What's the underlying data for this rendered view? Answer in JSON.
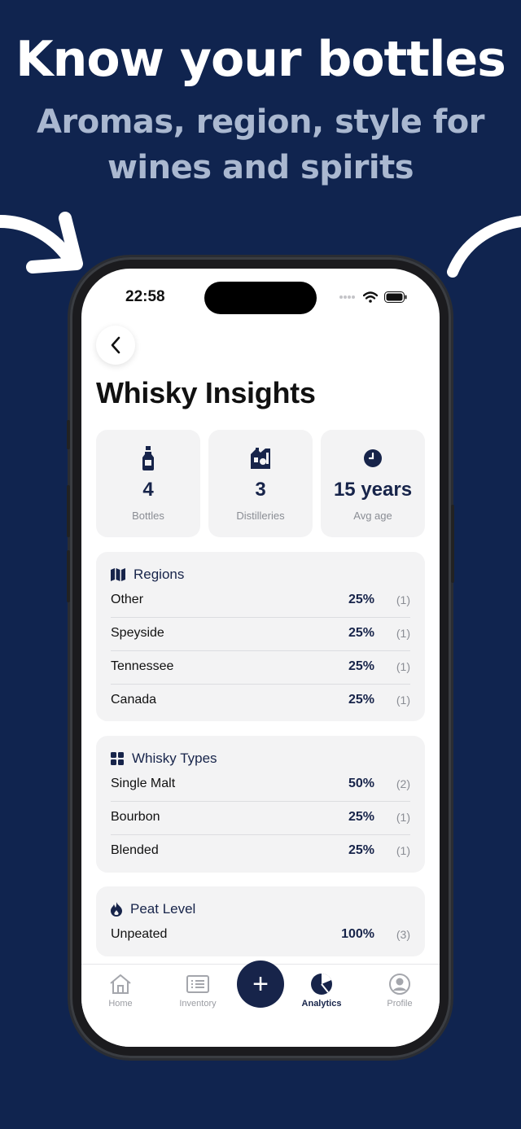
{
  "promo": {
    "headline": "Know your bottles",
    "subline_1": "Aromas, region, style for",
    "subline_2": "wines and spirits"
  },
  "colors": {
    "background": "#10244f",
    "accent": "#17244a",
    "card": "#f3f3f4",
    "muted": "#8a8d94"
  },
  "status_bar": {
    "time": "22:58"
  },
  "page": {
    "title": "Whisky Insights"
  },
  "stats": [
    {
      "value": "4",
      "label": "Bottles",
      "icon": "bottle-icon"
    },
    {
      "value": "3",
      "label": "Distilleries",
      "icon": "distillery-icon"
    },
    {
      "value": "15 years",
      "label": "Avg age",
      "icon": "clock-icon"
    }
  ],
  "regions": {
    "title": "Regions",
    "icon": "map-icon",
    "rows": [
      {
        "name": "Other",
        "percent": "25%",
        "count": "(1)"
      },
      {
        "name": "Speyside",
        "percent": "25%",
        "count": "(1)"
      },
      {
        "name": "Tennessee",
        "percent": "25%",
        "count": "(1)"
      },
      {
        "name": "Canada",
        "percent": "25%",
        "count": "(1)"
      }
    ]
  },
  "types": {
    "title": "Whisky Types",
    "icon": "grid-icon",
    "rows": [
      {
        "name": "Single Malt",
        "percent": "50%",
        "count": "(2)"
      },
      {
        "name": "Bourbon",
        "percent": "25%",
        "count": "(1)"
      },
      {
        "name": "Blended",
        "percent": "25%",
        "count": "(1)"
      }
    ]
  },
  "peat": {
    "title": "Peat Level",
    "icon": "flame-icon",
    "rows": [
      {
        "name": "Unpeated",
        "percent": "100%",
        "count": "(3)"
      }
    ]
  },
  "tabbar": {
    "items": [
      {
        "label": "Home",
        "icon": "home-icon"
      },
      {
        "label": "Inventory",
        "icon": "list-icon"
      },
      {
        "label": "Analytics",
        "icon": "pie-chart-icon",
        "active": true
      },
      {
        "label": "Profile",
        "icon": "profile-icon"
      }
    ],
    "fab": "+"
  }
}
